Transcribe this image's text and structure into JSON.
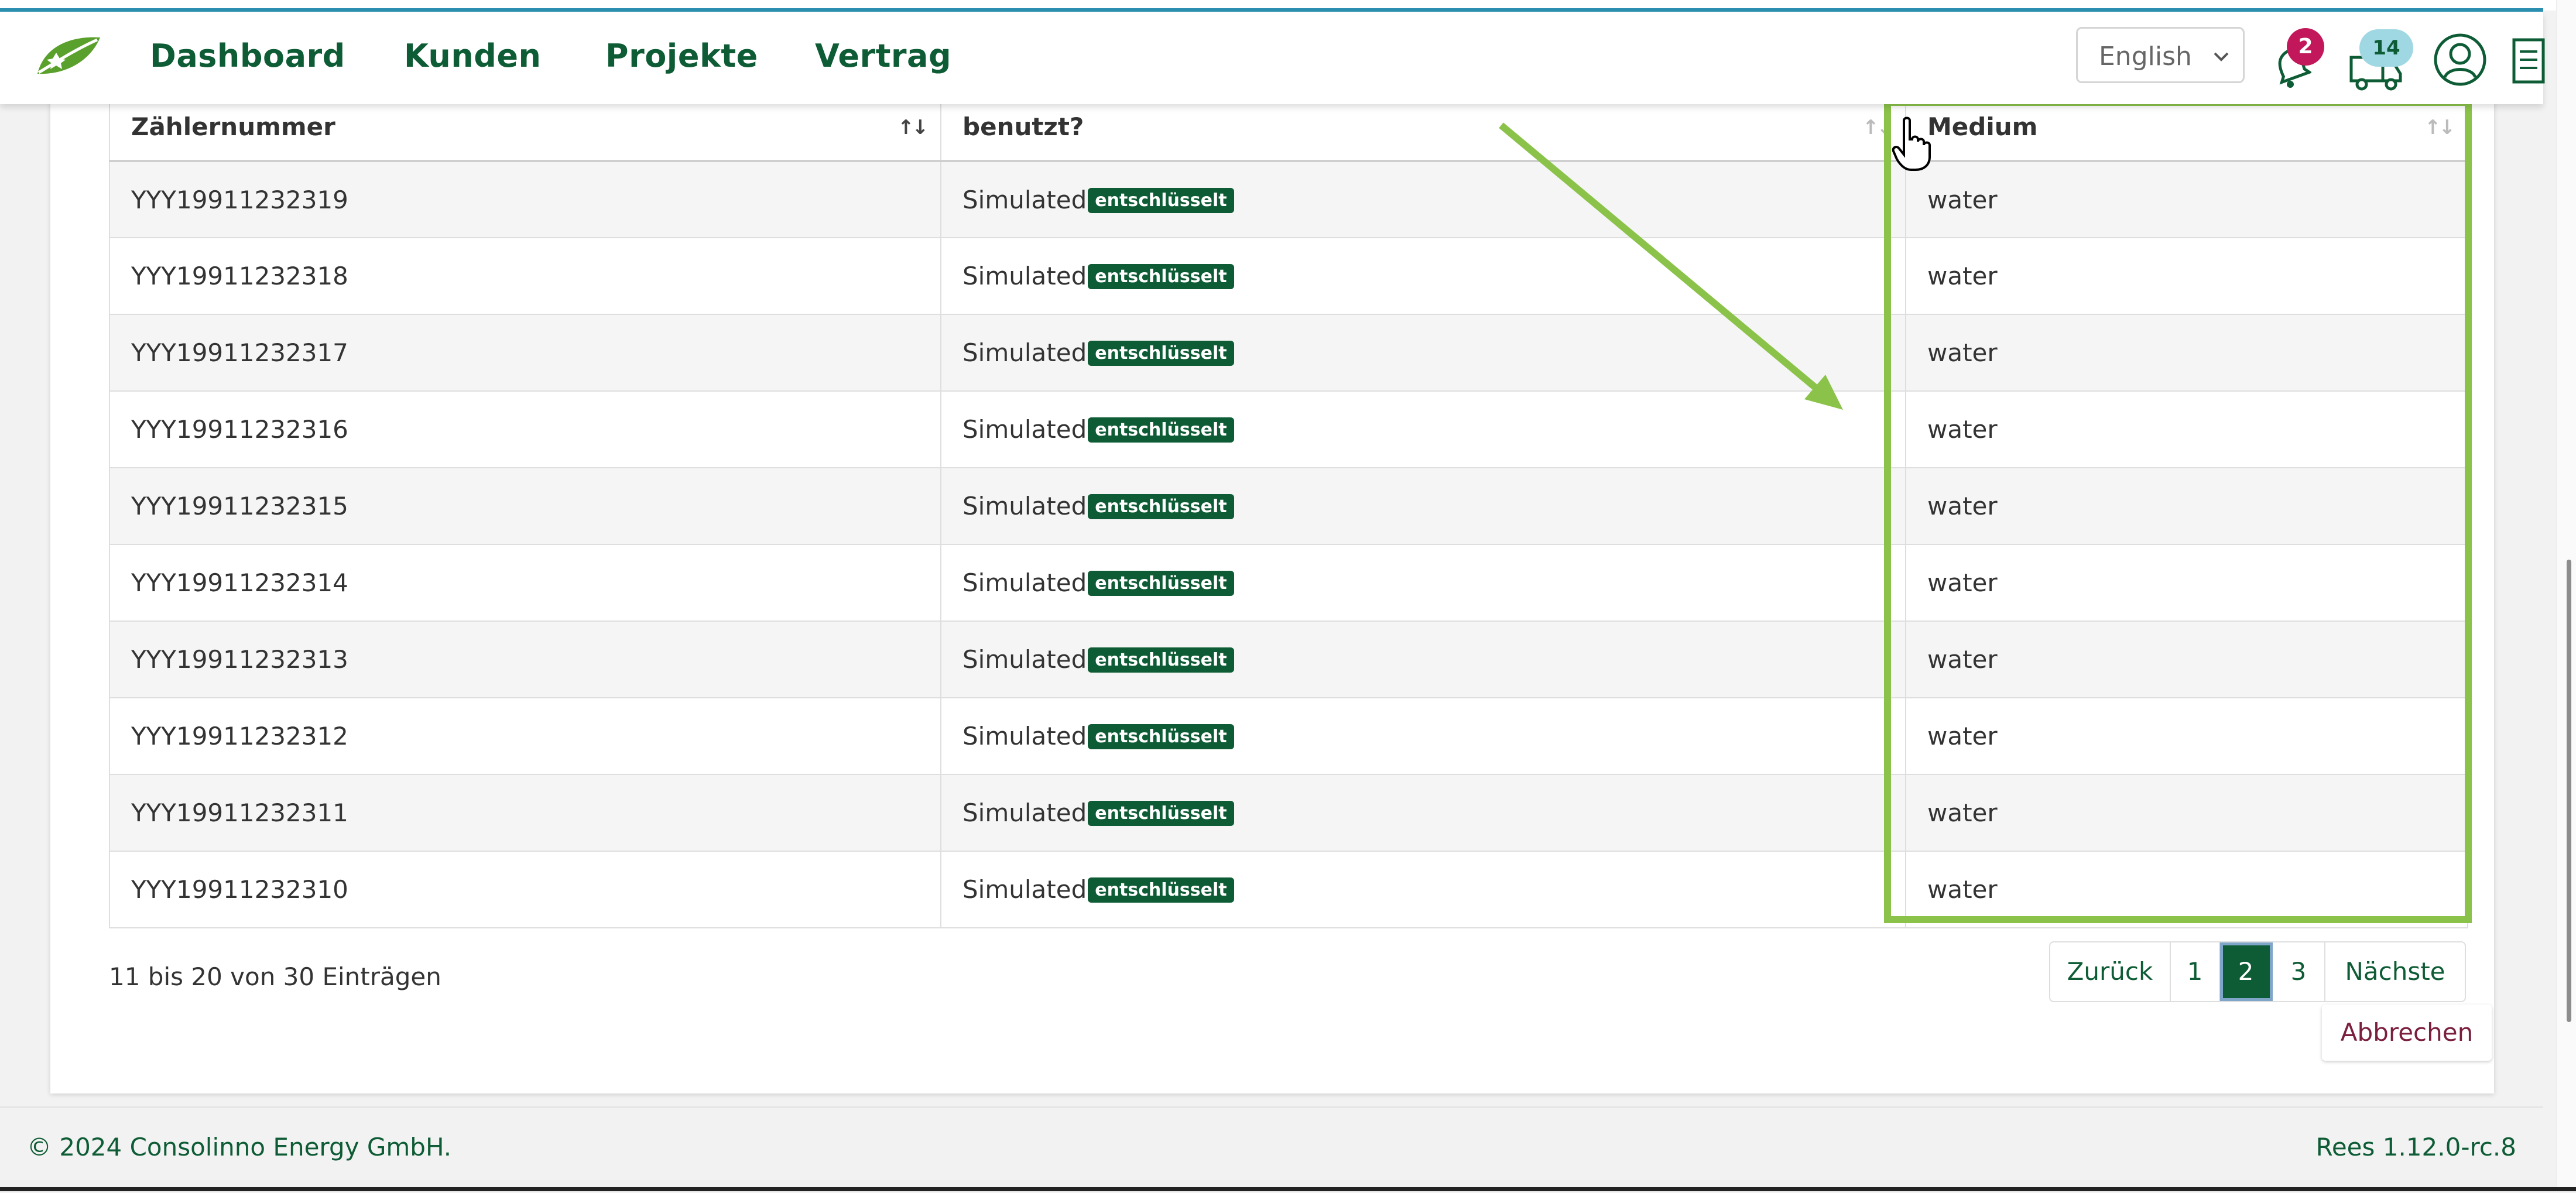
{
  "header": {
    "nav": [
      "Dashboard",
      "Kunden",
      "Projekte",
      "Vertrag"
    ],
    "language": "English",
    "notifications_count": "2",
    "messages_count": "14",
    "icons": [
      "leaf-logo-icon",
      "bell-icon",
      "truck-icon",
      "user-icon",
      "document-icon"
    ]
  },
  "table": {
    "columns": [
      "Zählernummer",
      "benutzt?",
      "Medium"
    ],
    "rows": [
      {
        "meter": "YYY19911232319",
        "used": "Simulated",
        "tag": "entschlüsselt",
        "medium": "water"
      },
      {
        "meter": "YYY19911232318",
        "used": "Simulated",
        "tag": "entschlüsselt",
        "medium": "water"
      },
      {
        "meter": "YYY19911232317",
        "used": "Simulated",
        "tag": "entschlüsselt",
        "medium": "water"
      },
      {
        "meter": "YYY19911232316",
        "used": "Simulated",
        "tag": "entschlüsselt",
        "medium": "water"
      },
      {
        "meter": "YYY19911232315",
        "used": "Simulated",
        "tag": "entschlüsselt",
        "medium": "water"
      },
      {
        "meter": "YYY19911232314",
        "used": "Simulated",
        "tag": "entschlüsselt",
        "medium": "water"
      },
      {
        "meter": "YYY19911232313",
        "used": "Simulated",
        "tag": "entschlüsselt",
        "medium": "water"
      },
      {
        "meter": "YYY19911232312",
        "used": "Simulated",
        "tag": "entschlüsselt",
        "medium": "water"
      },
      {
        "meter": "YYY19911232311",
        "used": "Simulated",
        "tag": "entschlüsselt",
        "medium": "water"
      },
      {
        "meter": "YYY19911232310",
        "used": "Simulated",
        "tag": "entschlüsselt",
        "medium": "water"
      }
    ]
  },
  "summary": "11 bis 20 von 30 Einträgen",
  "pagination": {
    "prev": "Zurück",
    "pages": [
      "1",
      "2",
      "3"
    ],
    "active": "2",
    "next": "Nächste"
  },
  "cancel": "Abbrechen",
  "footer": {
    "copyright": "© 2024 Consolinno Energy GmbH.",
    "version": "Rees 1.12.0-rc.8"
  },
  "colors": {
    "brand_green": "#0e5c35",
    "annotation_green": "#8bc34a",
    "notification_badge": "#c2185b",
    "messages_badge": "#9fd8e3"
  }
}
